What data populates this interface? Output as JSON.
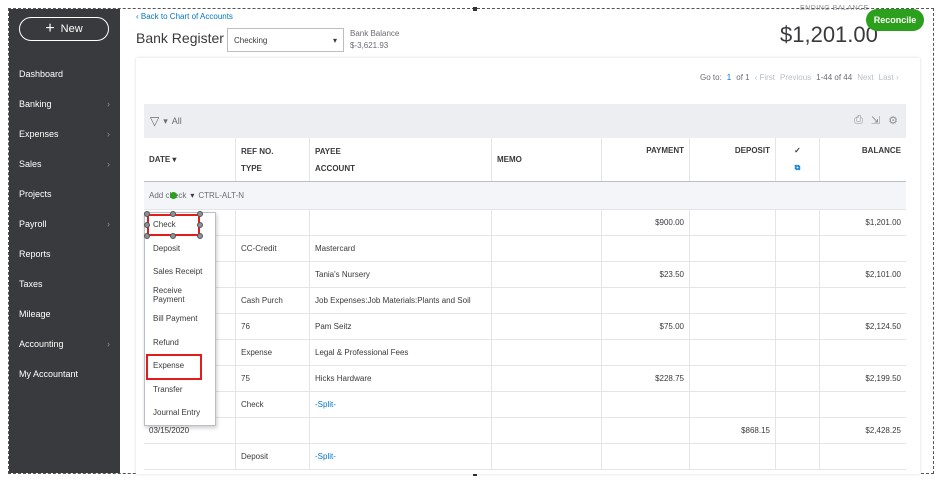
{
  "sidebar": {
    "new_label": "New",
    "items": [
      {
        "label": "Dashboard",
        "chevron": false
      },
      {
        "label": "Banking",
        "chevron": true
      },
      {
        "label": "Expenses",
        "chevron": true
      },
      {
        "label": "Sales",
        "chevron": true
      },
      {
        "label": "Projects",
        "chevron": false
      },
      {
        "label": "Payroll",
        "chevron": true
      },
      {
        "label": "Reports",
        "chevron": false
      },
      {
        "label": "Taxes",
        "chevron": false
      },
      {
        "label": "Mileage",
        "chevron": false
      },
      {
        "label": "Accounting",
        "chevron": true
      },
      {
        "label": "My Accountant",
        "chevron": false
      }
    ]
  },
  "header": {
    "back_link": "‹ Back to Chart of Accounts",
    "title": "Bank Register",
    "account": "Checking",
    "bank_balance_label": "Bank Balance",
    "bank_balance": "$-3,621.93",
    "ending_balance_label": "ENDING BALANCE",
    "ending_balance": "$1,201.00",
    "reconcile": "Reconcile"
  },
  "pager": {
    "goto": "Go to:",
    "page": "1",
    "of": "of 1",
    "first": "‹ First",
    "previous": "Previous",
    "range": "1-44 of 44",
    "next": "Next",
    "last": "Last ›"
  },
  "toolbar": {
    "filter": "All"
  },
  "table": {
    "headers": {
      "date": "DATE ▾",
      "ref": "REF NO.",
      "type": "TYPE",
      "payee": "PAYEE",
      "account": "ACCOUNT",
      "memo": "MEMO",
      "payment": "PAYMENT",
      "deposit": "DEPOSIT",
      "check": "✓",
      "balance": "BALANCE"
    },
    "add_row": {
      "label": "Add check",
      "shortcut": "CTRL-ALT-N"
    },
    "rows": [
      {
        "date": "",
        "ref": "",
        "payee": "",
        "memo": "",
        "payment": "$900.00",
        "deposit": "",
        "balance": "$1,201.00"
      },
      {
        "date": "",
        "ref": "CC-Credit",
        "payee": "Mastercard",
        "memo": "",
        "payment": "",
        "deposit": "",
        "balance": ""
      },
      {
        "date": "",
        "ref": "",
        "payee": "Tania's Nursery",
        "memo": "",
        "payment": "$23.50",
        "deposit": "",
        "balance": "$2,101.00"
      },
      {
        "date": "",
        "ref": "Cash Purch",
        "payee": "Job Expenses:Job Materials:Plants and Soil",
        "memo": "",
        "payment": "",
        "deposit": "",
        "balance": ""
      },
      {
        "date": "",
        "ref": "76",
        "payee": "Pam Seitz",
        "memo": "",
        "payment": "$75.00",
        "deposit": "",
        "balance": "$2,124.50"
      },
      {
        "date": "",
        "ref": "Expense",
        "payee": "Legal & Professional Fees",
        "memo": "",
        "payment": "",
        "deposit": "",
        "balance": ""
      },
      {
        "date": "",
        "ref": "75",
        "payee": "Hicks Hardware",
        "memo": "",
        "payment": "$228.75",
        "deposit": "",
        "balance": "$2,199.50"
      },
      {
        "date": "",
        "ref": "Check",
        "payee": "-Split-",
        "memo": "",
        "payment": "",
        "deposit": "",
        "balance": ""
      },
      {
        "date": "03/15/2020",
        "ref": "",
        "payee": "",
        "memo": "",
        "payment": "",
        "deposit": "$868.15",
        "balance": "$2,428.25"
      },
      {
        "date": "",
        "ref": "Deposit",
        "payee": "-Split-",
        "memo": "",
        "payment": "",
        "deposit": "",
        "balance": ""
      }
    ]
  },
  "dropdown": {
    "items": [
      "Check",
      "Deposit",
      "Sales Receipt",
      "Receive Payment",
      "Bill Payment",
      "Refund",
      "Expense",
      "Transfer",
      "Journal Entry"
    ]
  },
  "colors": {
    "sidebar": "#393a3d",
    "accent_green": "#2ca01c",
    "link_blue": "#0077c5",
    "highlight_red": "#e21b1b"
  }
}
